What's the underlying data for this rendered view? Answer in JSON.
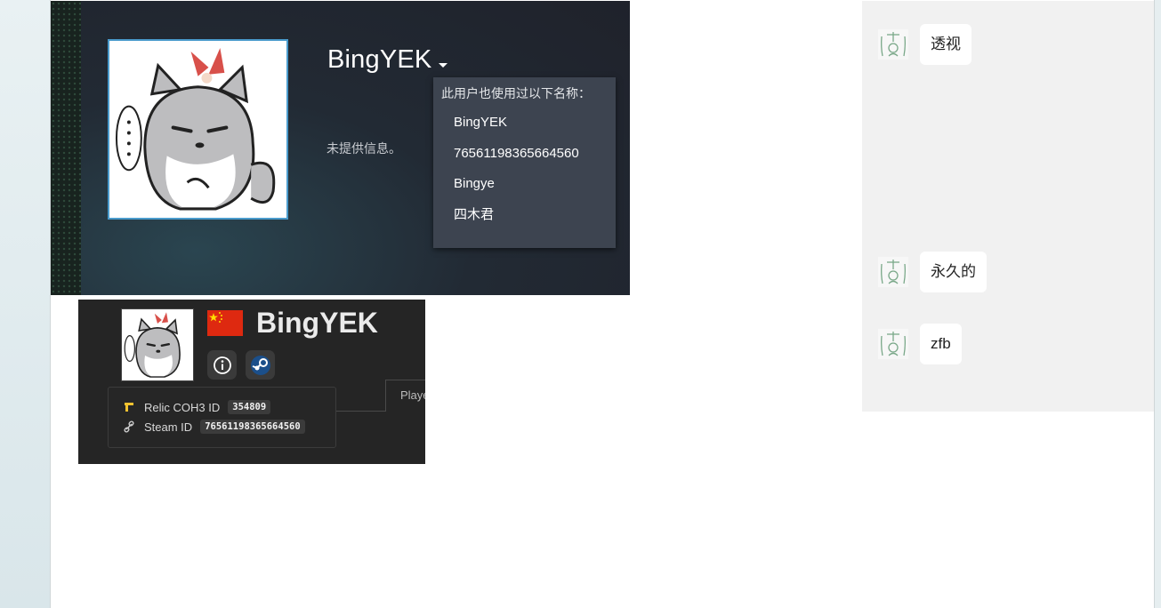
{
  "steam_profile": {
    "persona_name": "BingYEK",
    "summary": "未提供信息。",
    "alias_popup": {
      "title": "此用户也使用过以下名称：",
      "aliases": [
        "BingYEK",
        "76561198365664560",
        "Bingye",
        "四木君"
      ]
    }
  },
  "coh3_card": {
    "player_name": "BingYEK",
    "flag": "china-flag",
    "relic_label": "Relic COH3 ID",
    "relic_id": "354809",
    "steam_label": "Steam ID",
    "steam_id": "76561198365664560",
    "tab_partial": "Playe"
  },
  "comments": [
    {
      "text": "透视"
    },
    {
      "text": "永久的"
    },
    {
      "text": "zfb"
    }
  ],
  "colors": {
    "steam_bg": "#1f222b",
    "popup_bg": "#3d4450",
    "coh_bg": "#252525",
    "comment_bg": "#f1f1f1",
    "relic_icon": "#f2c230",
    "china_red": "#de2910",
    "china_yellow": "#ffde00"
  }
}
